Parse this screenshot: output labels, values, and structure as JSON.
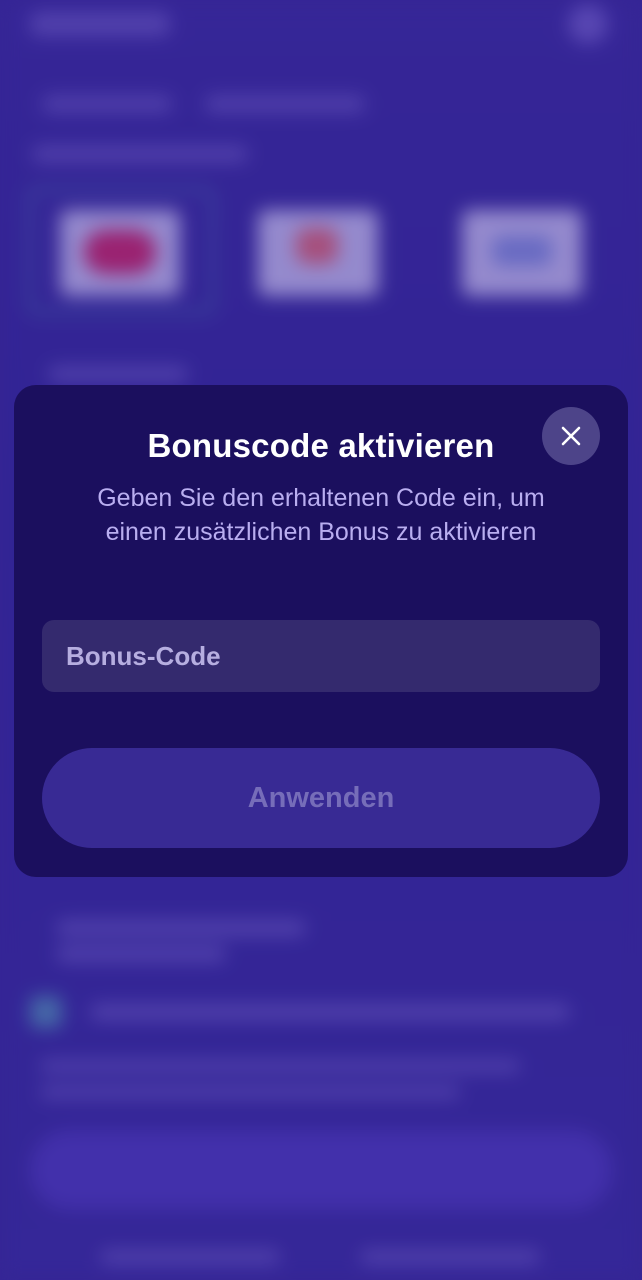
{
  "modal": {
    "title": "Bonuscode aktivieren",
    "subtitle": "Geben Sie den erhaltenen Code ein, um einen zusätzlichen Bonus zu aktivieren",
    "input_placeholder": "Bonus-Code",
    "input_value": "",
    "apply_label": "Anwenden"
  },
  "icons": {
    "close": "close-icon"
  },
  "colors": {
    "backdrop": "#3a2a9a",
    "modal_bg": "#1b0f5e",
    "input_bg": "#342a6e",
    "button_bg": "#382a94",
    "button_text_disabled": "#766db9",
    "subtitle": "#b9aef0"
  }
}
